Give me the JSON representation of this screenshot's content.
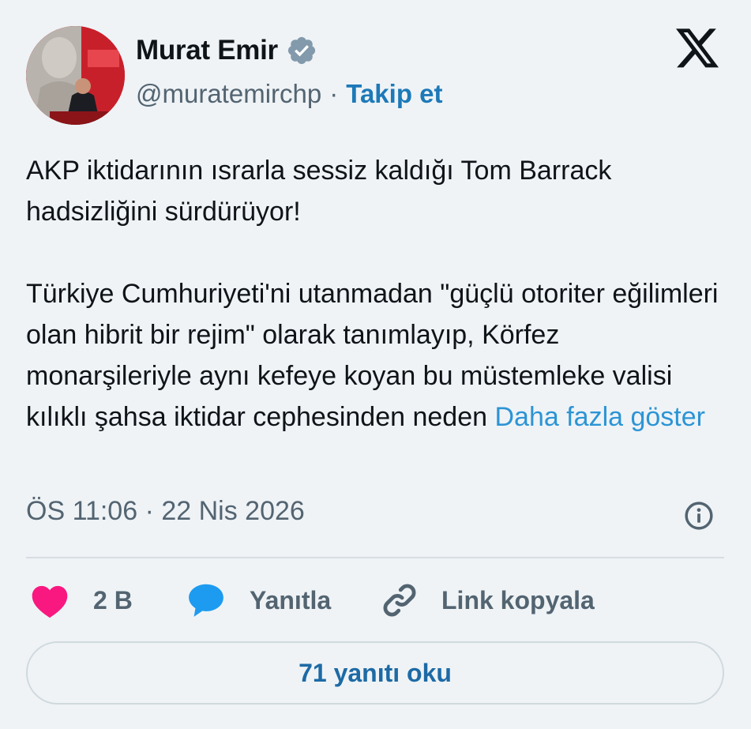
{
  "author": {
    "name": "Murat Emir",
    "handle": "@muratemirchp",
    "follow_label": "Takip et",
    "verified": true
  },
  "tweet": {
    "paragraph1": "AKP iktidarının ısrarla sessiz kaldığı Tom Barrack hadsizliğini sürdürüyor!",
    "paragraph2": "Türkiye Cumhuriyeti'ni utanmadan \"güçlü otoriter eğilimleri olan hibrit bir rejim\" olarak tanımlayıp, Körfez monarşileriyle aynı kefeye koyan bu müstemleke valisi kılıklı şahsa iktidar cephesinden neden",
    "show_more": "Daha fazla göster",
    "timestamp": "ÖS 11:06 · 22 Nis 2026"
  },
  "actions": {
    "likes": "2 B",
    "reply_label": "Yanıtla",
    "copy_link_label": "Link kopyala"
  },
  "read_replies_label": "71 yanıtı oku",
  "icons": {
    "platform": "x-logo-icon",
    "verified": "verified-badge-icon",
    "info": "info-icon",
    "like": "heart-icon",
    "reply": "speech-bubble-icon",
    "link": "link-icon"
  },
  "colors": {
    "background": "#eff3f6",
    "link": "#2c94d5",
    "follow": "#1d79b8",
    "heart": "#f91880",
    "reply_bubble": "#1d9bf0",
    "muted": "#536471"
  }
}
